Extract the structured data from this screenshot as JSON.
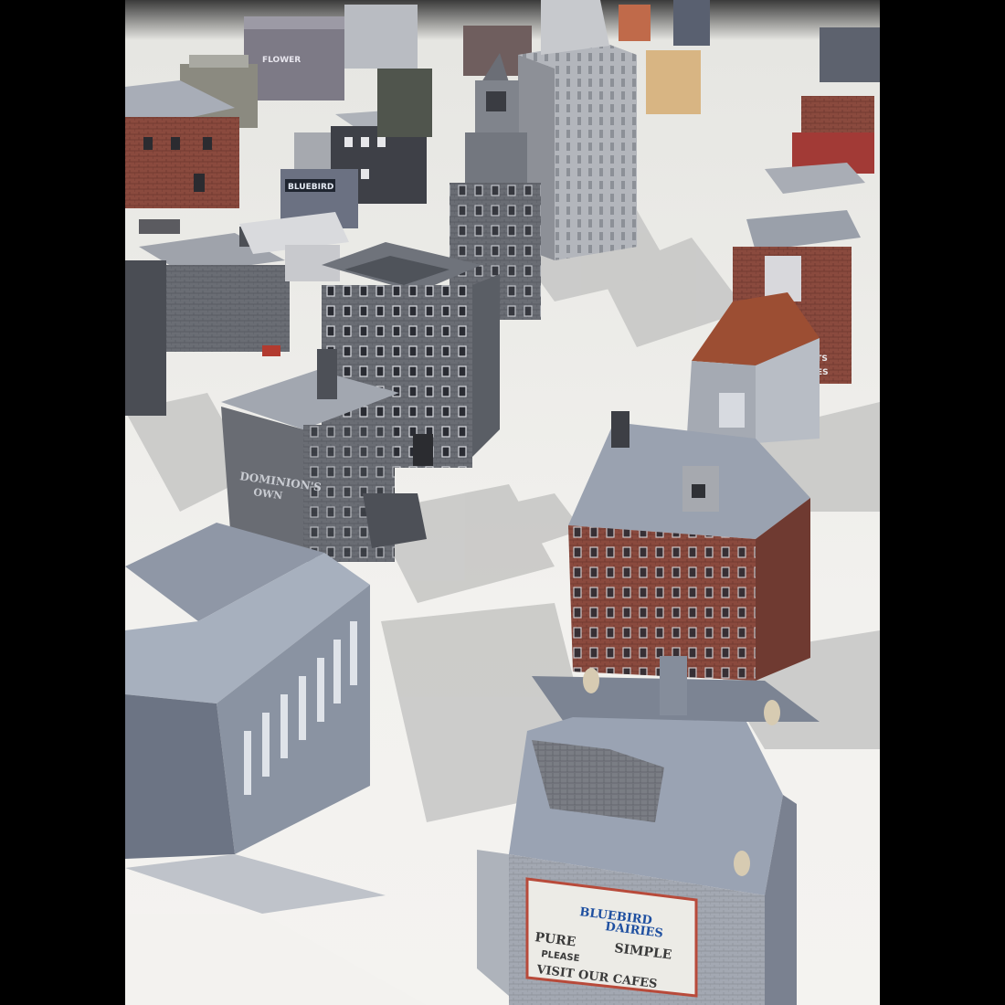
{
  "signs": {
    "dairy_line1": "BLUEBIRD",
    "dairy_line2": "DAIRIES",
    "dairy_line3": "PURE",
    "dairy_line4": "SIMPLE",
    "dairy_line5": "PLEASE",
    "dairy_line6": "VISIT OUR CAFES",
    "dominion_line1": "DOMINION'S",
    "dominion_line2": "OWN",
    "flower_line1": "FLOWER",
    "shop_sign": "BLUEBIRD",
    "ad_partial": "ATS",
    "ad_partial2": "VES"
  }
}
